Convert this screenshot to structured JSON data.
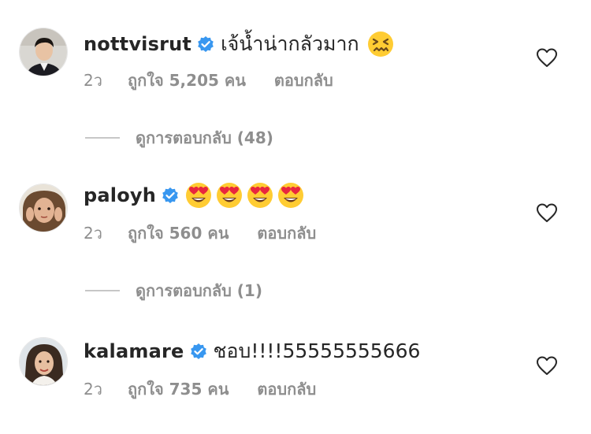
{
  "comments": [
    {
      "username": "nottvisrut",
      "verified": true,
      "text": "เจ้น้ำน่ากลัวมาก",
      "emojis": [
        "confounded-face"
      ],
      "time": "2ว",
      "likes": "ถูกใจ 5,205 คน",
      "reply_label": "ตอบกลับ",
      "view_replies": "ดูการตอบกลับ (48)"
    },
    {
      "username": "paloyh",
      "verified": true,
      "text": "",
      "emojis": [
        "heart-eyes-face",
        "heart-eyes-face",
        "heart-eyes-face",
        "heart-eyes-face"
      ],
      "time": "2ว",
      "likes": "ถูกใจ 560 คน",
      "reply_label": "ตอบกลับ",
      "view_replies": "ดูการตอบกลับ (1)"
    },
    {
      "username": "kalamare",
      "verified": true,
      "text": "ชอบ!!!!55555555666",
      "emojis": [],
      "time": "2ว",
      "likes": "ถูกใจ 735 คน",
      "reply_label": "ตอบกลับ"
    }
  ],
  "colors": {
    "text": "#262626",
    "secondary": "#8e8e8e",
    "verified_badge": "#3897f0",
    "divider": "#c7c7c7"
  }
}
